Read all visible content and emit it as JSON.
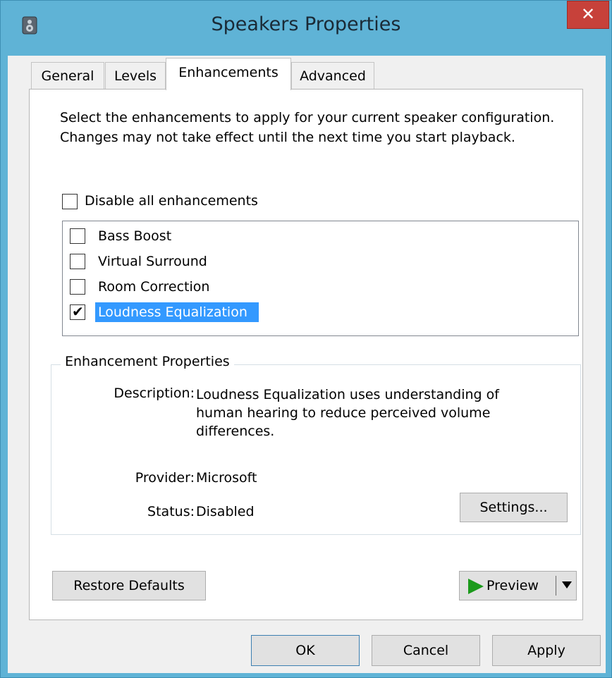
{
  "window": {
    "title": "Speakers Properties",
    "close_glyph": "✕",
    "app_icon": "speaker-icon",
    "close_color": "#c7413a",
    "frame_color": "#5fb3d6"
  },
  "tabs": [
    {
      "label": "General",
      "active": false
    },
    {
      "label": "Levels",
      "active": false
    },
    {
      "label": "Enhancements",
      "active": true
    },
    {
      "label": "Advanced",
      "active": false
    }
  ],
  "enhancements": {
    "intro": "Select the enhancements to apply for your current speaker configuration. Changes may not take effect until the next time you start playback.",
    "disable_all_label": "Disable all enhancements",
    "disable_all_checked": false,
    "items": [
      {
        "label": "Bass Boost",
        "checked": false,
        "selected": false
      },
      {
        "label": "Virtual Surround",
        "checked": false,
        "selected": false
      },
      {
        "label": "Room Correction",
        "checked": false,
        "selected": false
      },
      {
        "label": "Loudness Equalization",
        "checked": true,
        "selected": true
      }
    ],
    "check_glyph": "✔",
    "selection_color": "#3399ff"
  },
  "properties": {
    "group_title": "Enhancement Properties",
    "description_label": "Description:",
    "description_value": "Loudness Equalization uses understanding of human hearing to reduce perceived volume differences.",
    "provider_label": "Provider:",
    "provider_value": "Microsoft",
    "status_label": "Status:",
    "status_value": "Disabled",
    "settings_button": "Settings..."
  },
  "actions": {
    "restore_defaults": "Restore Defaults",
    "preview": "Preview",
    "ok": "OK",
    "cancel": "Cancel",
    "apply": "Apply",
    "preview_icon_color": "#1b9a1b"
  }
}
